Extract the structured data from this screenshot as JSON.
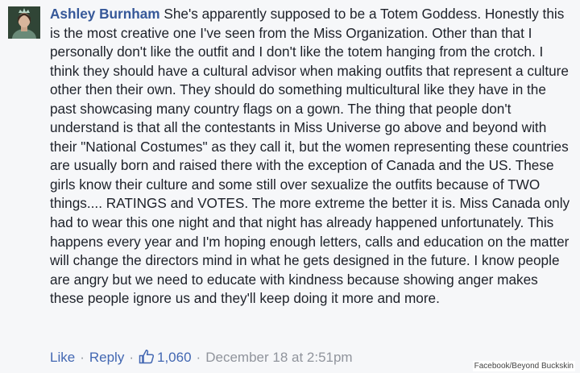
{
  "comment": {
    "author": "Ashley Burnham",
    "text": "She's apparently supposed to be a Totem Goddess. Honestly this is the most creative one I've seen from the Miss Organization. Other than that I personally don't like the outfit and I don't like the totem hanging from the crotch. I think they should have a cultural advisor when making outfits that represent a culture other then their own. They should do something multicultural like they have in the past showcasing many country flags on a gown. The thing that people don't understand is that all the contestants in Miss Universe go above and beyond with their \"National Costumes\" as they call it, but the women representing these countries are usually born and raised there with the exception of Canada and the US. These girls know their culture and some still over sexualize the outfits because of TWO things.... RATINGS and VOTES. The more extreme the better it is. Miss Canada only had to wear this one night and that night has already happened unfortunately. This happens every year and I'm hoping enough letters, calls and education on the matter will change the directors mind in what he gets designed in the future. I know people are angry but we need to educate with kindness because showing anger makes these people ignore us and they'll keep doing it more and more."
  },
  "actions": {
    "like": "Like",
    "reply": "Reply",
    "like_count": "1,060",
    "timestamp": "December 18 at 2:51pm",
    "separator": "·"
  },
  "icons": {
    "like": "thumbs-up-icon",
    "avatar": "profile-avatar"
  },
  "colors": {
    "author": "#365899",
    "link": "#4267b2",
    "meta": "#90949c",
    "text": "#1d2129",
    "background": "#f6f7f9"
  },
  "credit": "Facebook/Beyond Buckskin"
}
